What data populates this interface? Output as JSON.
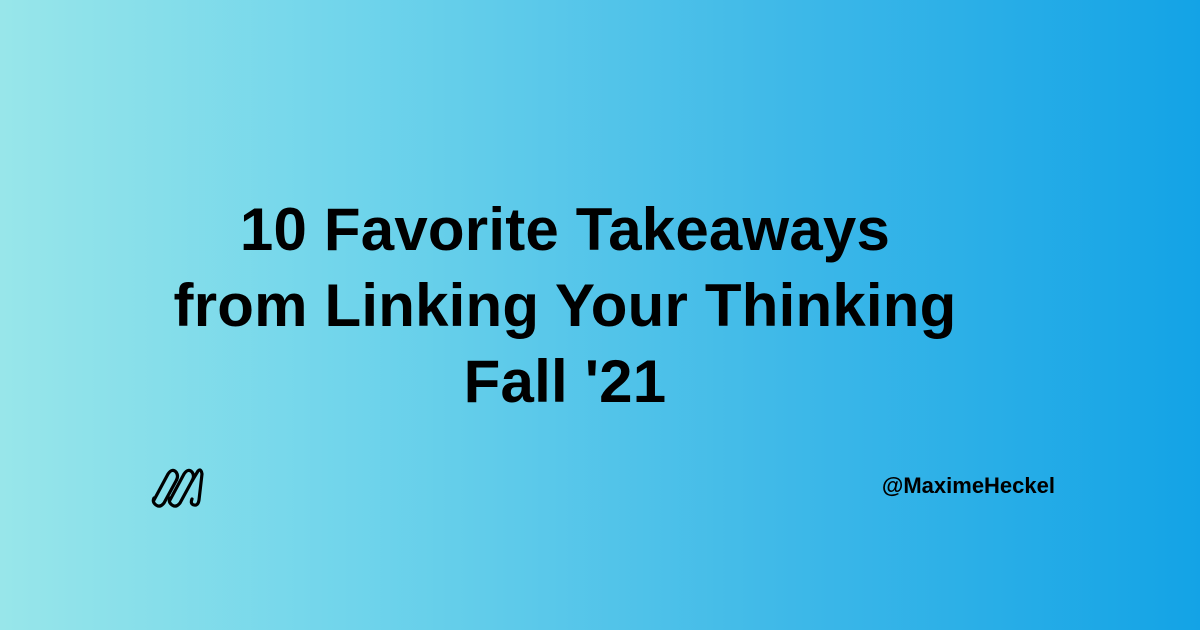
{
  "card": {
    "title_lines": [
      "10 Favorite Takeaways",
      "from Linking Your Thinking",
      "Fall '21"
    ],
    "handle": "@MaximeHeckel",
    "logo_icon": "maxime-heckel-logo-icon",
    "colors": {
      "gradient_start": "#98e6ea",
      "gradient_end": "#13a3e6",
      "text": "#000000"
    }
  }
}
